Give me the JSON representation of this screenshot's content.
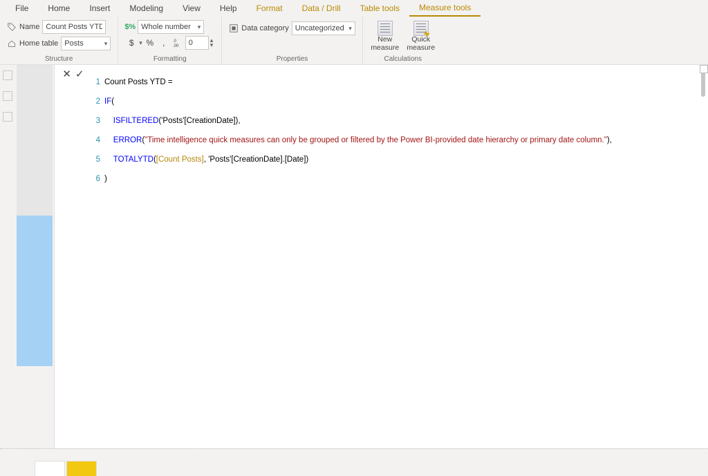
{
  "tabs": {
    "file": "File",
    "home": "Home",
    "insert": "Insert",
    "modeling": "Modeling",
    "view": "View",
    "help": "Help",
    "format": "Format",
    "data_drill": "Data / Drill",
    "table_tools": "Table tools",
    "measure_tools": "Measure tools"
  },
  "ribbon": {
    "structure": {
      "name_label": "Name",
      "name_value": "Count Posts YTD",
      "home_table_label": "Home table",
      "home_table_value": "Posts",
      "group_label": "Structure"
    },
    "formatting": {
      "format_value": "Whole number",
      "dollar": "$",
      "percent": "%",
      "comma": ",",
      "dec_inc": ".0",
      "dec_dec": ".00",
      "decimals_value": "0",
      "group_label": "Formatting"
    },
    "properties": {
      "data_category_label": "Data category",
      "data_category_value": "Uncategorized",
      "group_label": "Properties"
    },
    "calculations": {
      "new_measure": "New measure",
      "quick_measure": "Quick measure",
      "group_label": "Calculations"
    }
  },
  "editor": {
    "cancel": "✕",
    "commit": "✓",
    "lines": [
      {
        "n": "1",
        "plain": "Count Posts YTD = "
      },
      {
        "n": "2",
        "kw": "IF",
        "plain": "("
      },
      {
        "n": "3",
        "indent": "    ",
        "kw": "ISFILTERED",
        "plain1": "(",
        "ref": "'Posts'[CreationDate]",
        "plain2": "),"
      },
      {
        "n": "4",
        "indent": "    ",
        "kw": "ERROR",
        "plain1": "(",
        "str": "\"Time intelligence quick measures can only be grouped or filtered by the Power BI-provided date hierarchy or primary date column.\"",
        "plain2": "),"
      },
      {
        "n": "5",
        "indent": "    ",
        "kw": "TOTALYTD",
        "plain1": "(",
        "ref": "[Count Posts]",
        "mid": ", ",
        "ref2": "'Posts'[CreationDate].[Date]",
        "plain2": ")"
      },
      {
        "n": "6",
        "plain": ")"
      }
    ]
  },
  "page_tabs": {
    "p1": "",
    "p2": ""
  }
}
